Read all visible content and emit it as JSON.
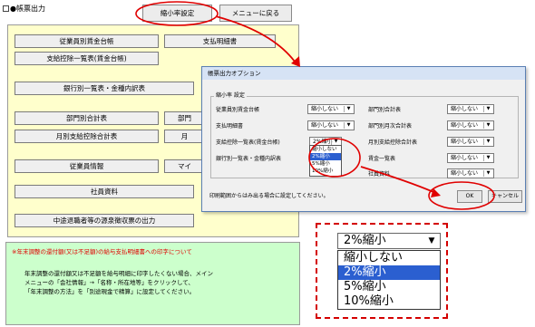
{
  "header": {
    "title": "帳票出力"
  },
  "topbar": {
    "zoom_btn": "縮小率設定",
    "back_btn": "メニューに戻る"
  },
  "main_buttons": {
    "employee_ledger": "従業員別賃金台帳",
    "pay_slip": "支払明細書",
    "pay_summary": "支給控除一覧表(賃金台帳)",
    "bank_list": "銀行別一覧表・金種内訳表",
    "dept_total": "部門別合計表",
    "dept_total_b": "部門",
    "monthly_total": "月別支給控除合計表",
    "monthly_total_b": "月",
    "employee_info": "従業員情報",
    "employee_info_b": "マイ",
    "company_info": "社員資料",
    "withholding": "中途退職者等の源泉徴収票の出力"
  },
  "notice": {
    "title": "※年末調整の還付額(又は不足額)の給与支払明細書への印字について",
    "lines": [
      "年末調整の還付額又は不足額を給与明細に印字したくない場合、メイン",
      "メニューの「会社情報」→「名称・所在地等」をクリックして、",
      "「年末調整の方法」を「別途現金で精算」に設定してください。"
    ]
  },
  "dialog": {
    "title": "帳票出力オプション",
    "group_title": "縮小率 設定",
    "rows_left": [
      {
        "label": "従業員別賃金台帳",
        "value": "縮小しない"
      },
      {
        "label": "支払明細書",
        "value": "縮小しない"
      },
      {
        "label": "支給控除一覧表(賃金台帳)",
        "value": "2%縮小"
      },
      {
        "label": "銀行別一覧表・金種内訳表",
        "value": ""
      }
    ],
    "rows_right": [
      {
        "label": "部門別合計表",
        "value": "縮小しない"
      },
      {
        "label": "部門別月次合計表",
        "value": "縮小しない"
      },
      {
        "label": "月別支給控除合計表",
        "value": "縮小しない"
      },
      {
        "label": "賃金一覧表",
        "value": "縮小しない"
      },
      {
        "label": "社員資料",
        "value": "縮小しない"
      }
    ],
    "options": [
      "縮小しない",
      "2%縮小",
      "5%縮小",
      "10%縮小"
    ],
    "selected_index": 1,
    "note": "印刷範囲からはみ出る場合に設定してください。",
    "ok": "OK",
    "cancel": "キャンセル"
  },
  "zoom": {
    "value": "2%縮小",
    "options": [
      "縮小しない",
      "2%縮小",
      "5%縮小",
      "10%縮小"
    ],
    "selected_index": 1
  },
  "annot_color": "#e00000"
}
